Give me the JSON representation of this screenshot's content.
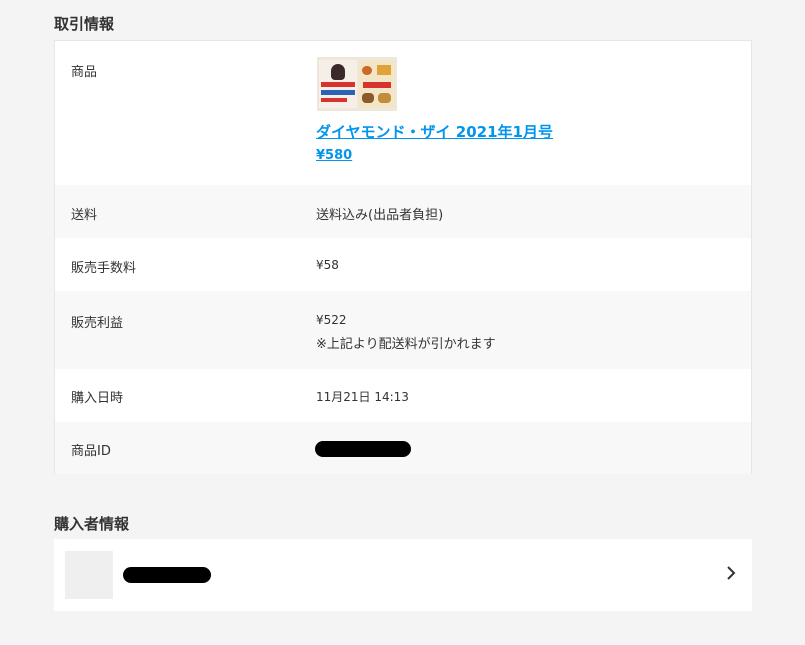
{
  "sections": {
    "trade_title": "取引情報",
    "buyer_title": "購入者情報"
  },
  "trade": {
    "product_label": "商品",
    "product_name": "ダイヤモンド・ザイ 2021年1月号",
    "product_price": "¥580",
    "shipping_label": "送料",
    "shipping_value": "送料込み(出品者負担)",
    "fee_label": "販売手数料",
    "fee_value": "¥58",
    "profit_label": "販売利益",
    "profit_value": "¥522",
    "profit_note": "※上記より配送料が引かれます",
    "purchase_date_label": "購入日時",
    "purchase_date_value": "11月21日 14:13",
    "item_id_label": "商品ID"
  },
  "icons": {
    "thumbnail": "product-thumbnail-image",
    "buyer_avatar": "avatar-placeholder",
    "chevron": "chevron-right-icon"
  },
  "colors": {
    "link": "#0095ee",
    "background": "#f4f4f4",
    "row_alt": "#f8f8f8"
  }
}
